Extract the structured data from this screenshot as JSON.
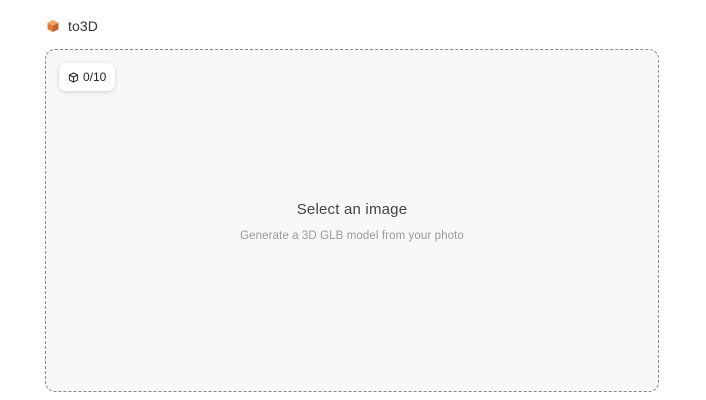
{
  "app": {
    "title": "to3D",
    "logo_icon": "orange-cube-icon",
    "accent_color": "#e07b39"
  },
  "dropzone": {
    "counter": {
      "icon": "cube-outline-icon",
      "text": "0/10"
    },
    "title": "Select an image",
    "subtitle": "Generate a 3D GLB model from your photo"
  }
}
